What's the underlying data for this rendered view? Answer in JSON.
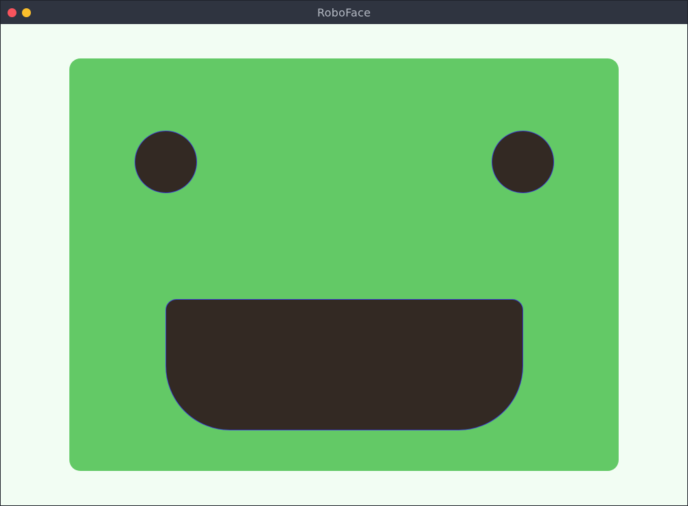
{
  "window": {
    "title": "RoboFace",
    "controls": [
      {
        "name": "close",
        "color": "#f8545d"
      },
      {
        "name": "minimize",
        "color": "#fbbf2c"
      }
    ],
    "titlebar_color": "#2f3440",
    "background_color": "#f2fdf3"
  },
  "face": {
    "color": "#63c966",
    "feature_color": "#332923",
    "outline_color": "#3b3fcf",
    "eyes": [
      "left-eye",
      "right-eye"
    ],
    "mouth": "mouth"
  }
}
